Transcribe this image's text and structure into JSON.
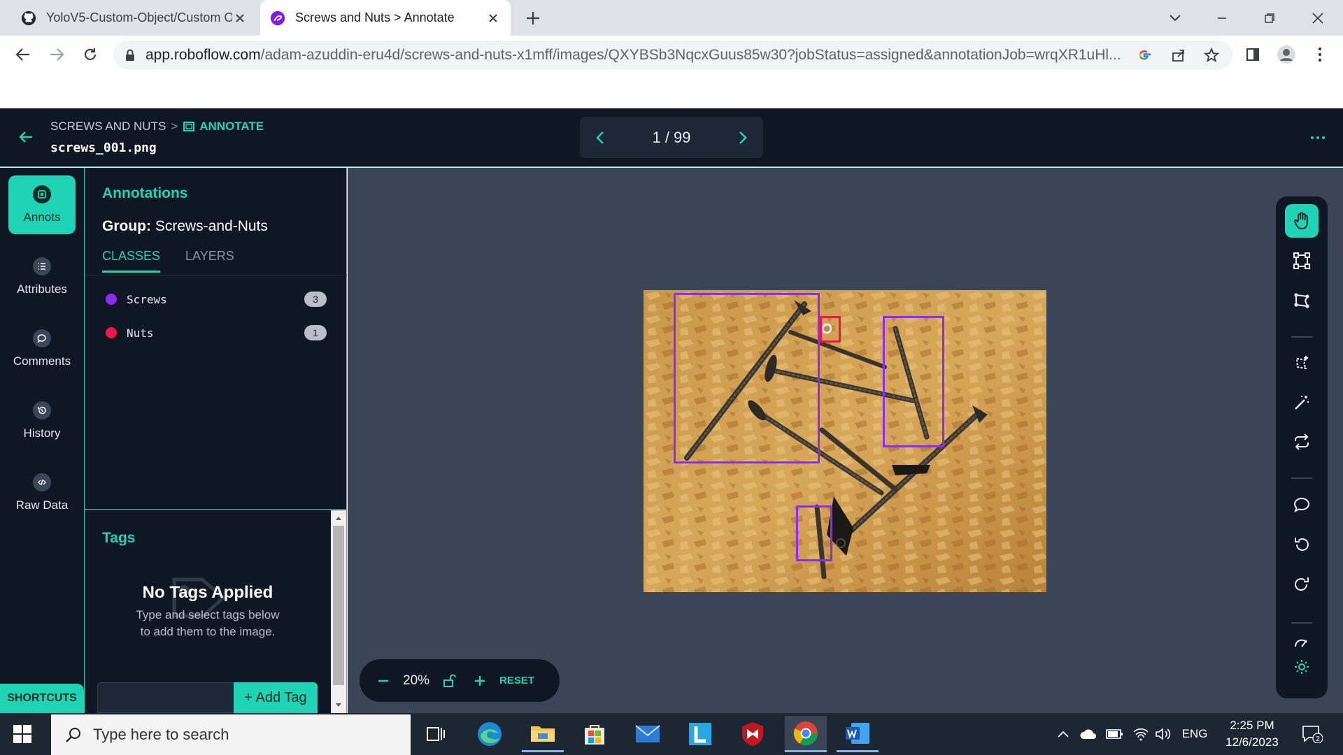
{
  "browser": {
    "tabs": [
      {
        "title": "YoloV5-Custom-Object/Custom O",
        "active": false,
        "icon": "github-icon"
      },
      {
        "title": "Screws and Nuts > Annotate",
        "active": true,
        "icon": "roboflow-icon"
      }
    ],
    "url_host": "app.roboflow.com",
    "url_rest": "/adam-azuddin-eru4d/screws-and-nuts-x1mff/images/QXYBSb3NqcxGuus85w30?jobStatus=assigned&annotationJob=wrqXR1uHl..."
  },
  "header": {
    "project": "SCREWS AND NUTS",
    "separator": ">",
    "current": "ANNOTATE",
    "filename": "screws_001.png",
    "pager": "1 / 99"
  },
  "rail": {
    "items": [
      {
        "label": "Annots",
        "icon": "annotation-icon"
      },
      {
        "label": "Attributes",
        "icon": "list-icon"
      },
      {
        "label": "Comments",
        "icon": "comment-icon"
      },
      {
        "label": "History",
        "icon": "history-icon"
      },
      {
        "label": "Raw Data",
        "icon": "code-icon"
      }
    ],
    "shortcuts": "SHORTCUTS"
  },
  "panel": {
    "title": "Annotations",
    "group_label": "Group:",
    "group_value": "Screws-and-Nuts",
    "tabs": [
      "CLASSES",
      "LAYERS"
    ],
    "classes": [
      {
        "name": "Screws",
        "count": "3",
        "color": "#8a2cf5"
      },
      {
        "name": "Nuts",
        "count": "1",
        "color": "#f2134f"
      }
    ],
    "tags_title": "Tags",
    "no_tags_title": "No Tags Applied",
    "no_tags_line1": "Type and select tags below",
    "no_tags_line2": "to add them to the image.",
    "add_tag": "+ Add Tag"
  },
  "canvas": {
    "zoom": "20%",
    "reset": "RESET"
  },
  "tools": [
    "hand-tool-icon",
    "bounding-box-icon",
    "polygon-icon",
    "smart-polygon-icon",
    "magic-wand-icon",
    "repeat-icon",
    "comment-icon",
    "undo-icon",
    "redo-icon",
    "speed-icon",
    "settings-icon"
  ],
  "taskbar": {
    "search_placeholder": "Type here to search",
    "language": "ENG",
    "time": "2:25 PM",
    "date": "12/6/2023",
    "notifications": "2"
  },
  "colors": {
    "accent": "#1fd3b5",
    "dark": "#0f1724",
    "canvas": "#3a4558",
    "screw_box": "#8a2cf5",
    "nut_box": "#f2134f"
  }
}
